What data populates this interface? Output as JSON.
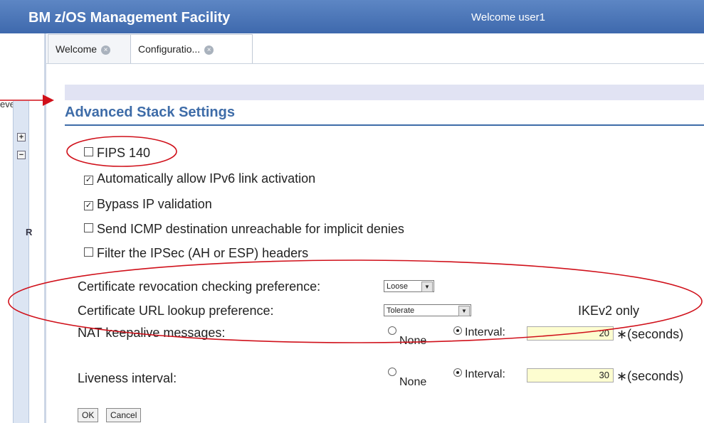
{
  "header": {
    "title": "BM z/OS Management Facility",
    "welcome": "Welcome user1"
  },
  "left": {
    "events_label": "events",
    "expand_glyph": "+",
    "collapse_glyph": "−",
    "r_button": "R"
  },
  "tabs": [
    {
      "label": "Welcome",
      "close": "×"
    },
    {
      "label": "Configuratio...",
      "close": "×"
    }
  ],
  "form": {
    "heading": "Advanced Stack Settings",
    "checkboxes": [
      {
        "label": "FIPS 140",
        "checked": false,
        "mark": ""
      },
      {
        "label": "Automatically allow IPv6 link activation",
        "checked": true,
        "mark": "✓"
      },
      {
        "label": "Bypass IP validation",
        "checked": true,
        "mark": "✓"
      },
      {
        "label": "Send ICMP destination unreachable for implicit denies",
        "checked": false,
        "mark": ""
      },
      {
        "label": "Filter the IPSec (AH or ESP) headers",
        "checked": false,
        "mark": ""
      }
    ],
    "cert_revocation": {
      "label": "Certificate revocation checking preference:",
      "value": "Loose",
      "arrow": "▼"
    },
    "cert_url": {
      "label": "Certificate URL lookup preference:",
      "value": "Tolerate",
      "arrow": "▼",
      "note": "IKEv2 only"
    },
    "nat": {
      "label": "NAT keepalive messages:",
      "none_label": "None",
      "interval_label": "Interval:",
      "value": "20",
      "unit": "∗(seconds)",
      "selected": "interval"
    },
    "liveness": {
      "label": "Liveness interval:",
      "none_label": "None",
      "interval_label": "Interval:",
      "value": "30",
      "unit": "∗(seconds)",
      "selected": "interval"
    },
    "buttons": {
      "ok": "OK",
      "cancel": "Cancel"
    }
  },
  "annotation_color": "#d0101a"
}
